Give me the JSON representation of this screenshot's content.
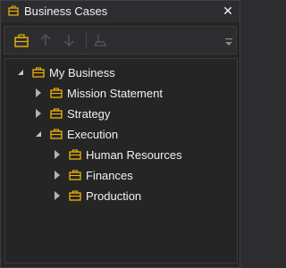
{
  "window": {
    "title": "Business Cases",
    "close_glyph": "✕"
  },
  "toolbar": {
    "buttons": [
      {
        "name": "new-case-button",
        "icon": "briefcase-icon",
        "enabled": true
      },
      {
        "name": "move-up-button",
        "icon": "arrow-up-icon",
        "enabled": false
      },
      {
        "name": "move-down-button",
        "icon": "arrow-down-icon",
        "enabled": false
      },
      {
        "name": "clear-button",
        "icon": "eraser-icon",
        "enabled": false
      }
    ]
  },
  "tree": {
    "root": {
      "label": "My Business",
      "expanded": true
    },
    "level1": [
      {
        "label": "Mission Statement",
        "expanded": false
      },
      {
        "label": "Strategy",
        "expanded": false
      },
      {
        "label": "Execution",
        "expanded": true
      }
    ],
    "level2": [
      {
        "label": "Human Resources",
        "expanded": false
      },
      {
        "label": "Finances",
        "expanded": false
      },
      {
        "label": "Production",
        "expanded": false
      }
    ]
  },
  "colors": {
    "accent_icon": "#f0b400",
    "panel_bg": "#252526",
    "titlebar_bg": "#2d2d30",
    "text": "#f1f1f1"
  }
}
